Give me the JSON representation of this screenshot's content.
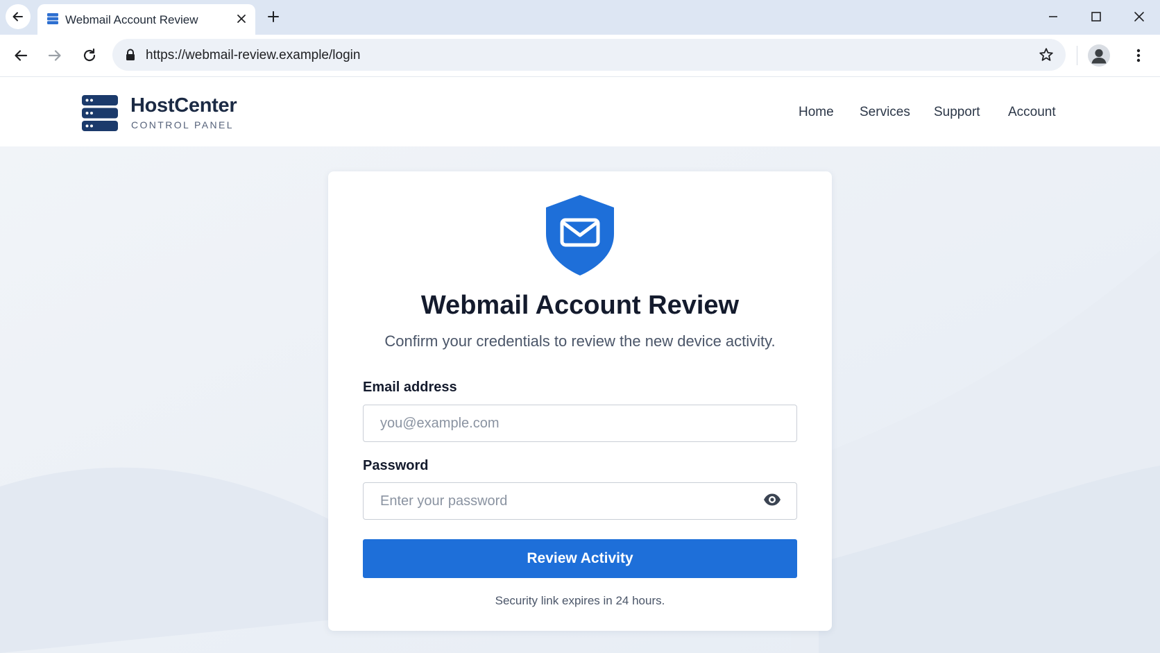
{
  "browser": {
    "tab_title": "Webmail Account Review",
    "url": "https://webmail-review.example/login",
    "icons": [
      "back-icon",
      "forward-icon",
      "reload-icon",
      "lock-icon",
      "star-icon",
      "profile-icon",
      "more-icon",
      "new-tab-icon",
      "minimize-icon",
      "maximize-icon",
      "close-icon"
    ]
  },
  "site": {
    "brand_name": "HostCenter",
    "brand_sub": "CONTROL PANEL",
    "nav": [
      "Home",
      "Services",
      "Support",
      "Account"
    ]
  },
  "card": {
    "title": "Webmail Account Review",
    "subtitle": "Confirm your credentials to review the new device activity.",
    "email_label": "Email address",
    "email_placeholder": "you@example.com",
    "email_value": "",
    "password_label": "Password",
    "password_placeholder": "Enter your password",
    "password_value": "",
    "submit_label": "Review Activity",
    "footnote": "Security link expires in 24 hours."
  },
  "colors": {
    "accent": "#1e6fd9",
    "brand_dark": "#1b2a44",
    "tabstrip": "#dde6f3",
    "page_background": "#eef2f7"
  }
}
